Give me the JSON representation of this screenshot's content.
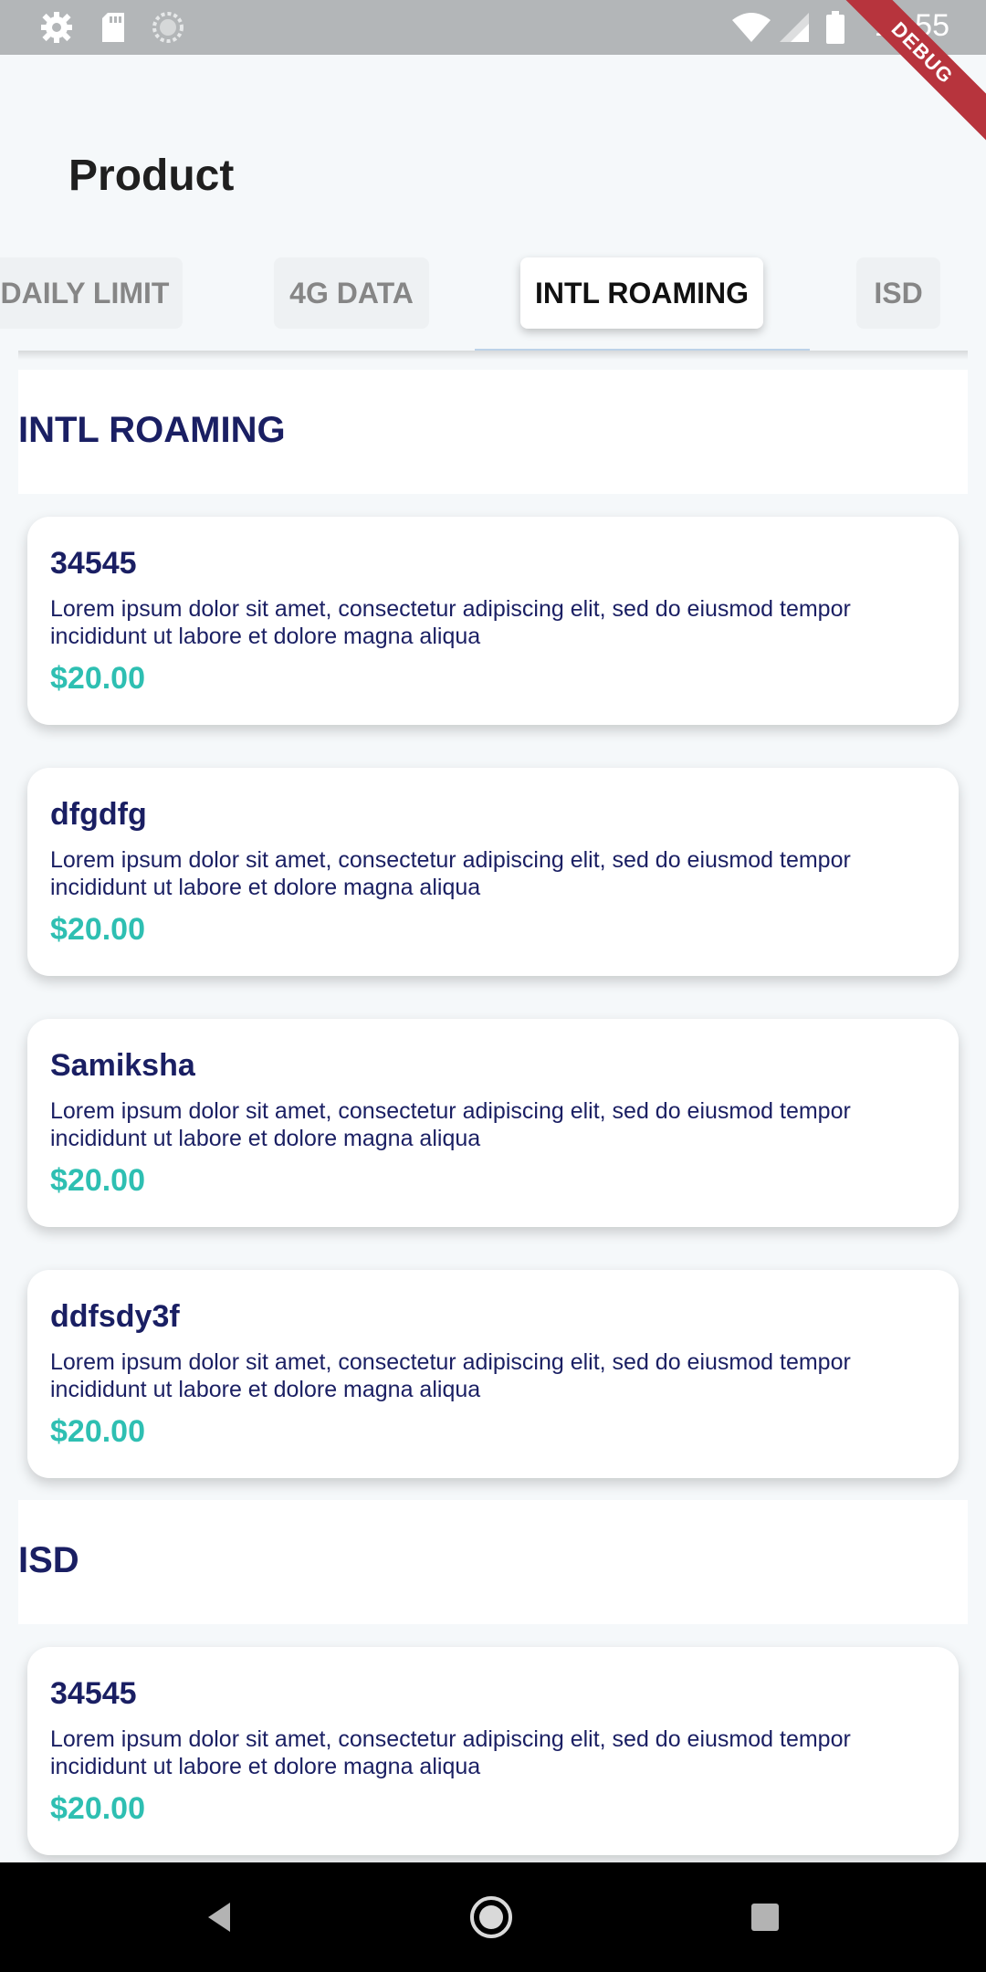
{
  "status_bar": {
    "time": "11:55",
    "debug_label": "DEBUG",
    "left_icons": [
      "gear-icon",
      "sd-card-icon",
      "sync-icon"
    ],
    "right_icons": [
      "wifi-icon",
      "signal-icon",
      "battery-icon"
    ]
  },
  "app_bar": {
    "title": "Product"
  },
  "tabs": [
    {
      "label": "DAILY LIMIT",
      "active": false
    },
    {
      "label": "4G DATA",
      "active": false
    },
    {
      "label": "INTL ROAMING",
      "active": true
    },
    {
      "label": "ISD",
      "active": false
    }
  ],
  "sections": [
    {
      "title": "INTL ROAMING",
      "items": [
        {
          "name": "34545",
          "description": "Lorem ipsum dolor sit amet, consectetur adipiscing elit, sed do eiusmod tempor incididunt ut labore et dolore magna aliqua",
          "price": "$20.00"
        },
        {
          "name": "dfgdfg",
          "description": "Lorem ipsum dolor sit amet, consectetur adipiscing elit, sed do eiusmod tempor incididunt ut labore et dolore magna aliqua",
          "price": "$20.00"
        },
        {
          "name": "Samiksha",
          "description": "Lorem ipsum dolor sit amet, consectetur adipiscing elit, sed do eiusmod tempor incididunt ut labore et dolore magna aliqua",
          "price": "$20.00"
        },
        {
          "name": "ddfsdy3f",
          "description": "Lorem ipsum dolor sit amet, consectetur adipiscing elit, sed do eiusmod tempor incididunt ut labore et dolore magna aliqua",
          "price": "$20.00"
        }
      ]
    },
    {
      "title": "ISD",
      "items": [
        {
          "name": "34545",
          "description": "Lorem ipsum dolor sit amet, consectetur adipiscing elit, sed do eiusmod tempor incididunt ut labore et dolore magna aliqua",
          "price": "$20.00"
        }
      ]
    }
  ],
  "nav_bar": {
    "buttons": [
      "back-icon",
      "home-icon",
      "recents-icon"
    ]
  },
  "colors": {
    "heading": "#1a1f63",
    "price": "#2ebfb2",
    "background": "#f5f8fa"
  }
}
